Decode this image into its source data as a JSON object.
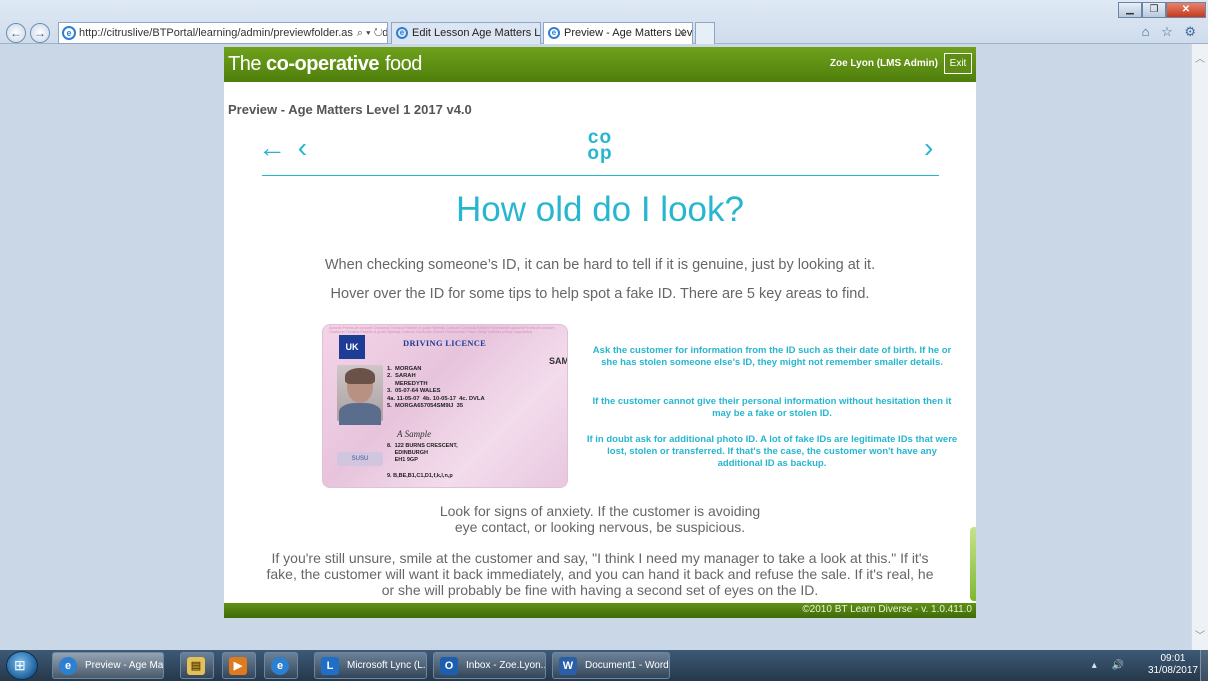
{
  "browser": {
    "address": "http://citruslive/BTPortal/learning/admin/previewfolder.aspx?folder",
    "address_controls": "⌕ ▾ ↻",
    "tabs": [
      {
        "label": "Edit Lesson Age Matters Level ..."
      },
      {
        "label": "Preview - Age Matters Leve...",
        "close": "✕"
      }
    ],
    "window_buttons": {
      "minimize": "▁",
      "maximize": "❐",
      "close": "✕"
    },
    "tool_icons": "⌂ ☆ ⚙"
  },
  "portal": {
    "brand": {
      "the": "The ",
      "coop": "co-operative",
      "food": "food"
    },
    "user": "Zoe Lyon (LMS Admin)",
    "exit_label": "Exit",
    "lesson_title": "Preview - Age Matters Level 1 2017 v4.0",
    "footer": "©2010 BT Learn Diverse - v. 1.0.411.0"
  },
  "slide": {
    "back_label": "← ‹",
    "next_label": "›",
    "logo_top": "co",
    "logo_bottom": "op",
    "heading": "How old do I look?",
    "para1": "When checking someone’s ID, it can be hard to tell if it is genuine, just by looking at it.",
    "para2": "Hover over the ID for some tips to help spot a fake ID. There are 5 key areas to find.",
    "licence": {
      "title": "DRIVING LICENCE",
      "eu_label": "UK",
      "lines": "1.  MORGAN\n2.  SARAH\n     MEREDYTH\n3.  05-07-64 WALES\n4a. 11-05-07  4b. 10-05-17  4c. DVLA\n5.  MORGA657054SM9IJ  35",
      "signature": "A Sample",
      "address": "8.  122 BURNS CRESCENT,\n     EDINBURGH\n     EH1 9GP",
      "categories": "9.  B,BE,B1,C1,D1,f,k,l,n,p",
      "sample": "SAMPLE",
      "hologram": "SUSU",
      "background_text": "Ajokortti Permis de conduire Ceadúnas Tiomána Patente di guida Rijbewijs Carta de Condução Körkort Führerschein Ajokortti Permis de conduire Ceadúnas Tiomána Patente di guida Rijbewijs Carta de Condução Körkort Führerschein Prawo Jazdy Vodičský průkaz Jogosítvány"
    },
    "tip1": "Ask the customer for information from the ID such as their date of birth. If he or she has stolen someone else's ID, they might not remember smaller details.",
    "tip2": "If the customer cannot give their personal information without hesitation then it may be a fake or stolen ID.",
    "tip3": "If in doubt ask for additional photo ID. A lot of fake IDs are legitimate IDs that were lost, stolen or transferred. If that's the case, the customer won't have any additional ID as backup.",
    "anxiety_line1": "Look for signs of anxiety. If the customer is avoiding",
    "anxiety_line2": "eye contact, or looking nervous, be suspicious.",
    "unsure": "If you're still unsure, smile at the customer and say, \"I think I need my manager to take a look at this.\" If it's fake, the customer will want it back immediately, and you can hand it back and refuse the sale. If it's real, he or she will probably be fine with having a second set of eyes on the ID."
  },
  "taskbar": {
    "items": [
      {
        "label": "Preview - Age Ma...",
        "icon": "internet-explorer-icon"
      },
      {
        "label": "",
        "icon": "windows-explorer-icon"
      },
      {
        "label": "",
        "icon": "media-player-icon"
      },
      {
        "label": "",
        "icon": "internet-explorer-icon"
      },
      {
        "label": "Microsoft Lync  (L...",
        "icon": "lync-icon"
      },
      {
        "label": "Inbox - Zoe.Lyon...",
        "icon": "outlook-icon"
      },
      {
        "label": "Document1 - Word",
        "icon": "word-icon"
      }
    ],
    "time": "09:01",
    "date": "31/08/2017",
    "tray_icons": "▴ 🔊"
  },
  "colors": {
    "brand_green": "#5a8a12",
    "accent_cyan": "#26b6cf",
    "text_grey": "#666666"
  }
}
